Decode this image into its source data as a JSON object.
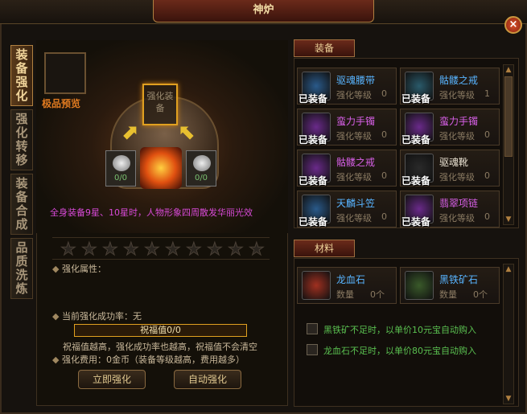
{
  "title": "神炉",
  "close_label": "×",
  "side_tabs": [
    {
      "label": "装备强化",
      "active": true
    },
    {
      "label": "强化转移",
      "active": false
    },
    {
      "label": "装备合成",
      "active": false
    },
    {
      "label": "品质洗炼",
      "active": false
    }
  ],
  "preview_label": "极品预览",
  "equip_slot_label": "强化装备",
  "stone_left_count": "0/0",
  "stone_right_count": "0/0",
  "description": "全身装备9星、10星时，人物形象四周散发华丽光效",
  "stars_total": 10,
  "stars_filled": 0,
  "attr_label": "强化属性：",
  "success_rate_label": "当前强化成功率：无",
  "bless_label": "祝福值0/0",
  "bless_fraction": 0,
  "bless_note": "祝福值越高，强化成功率也越高，祝福值不会清空",
  "cost_label": "强化费用：0金币（装备等级越高，费用越多）",
  "btn_strengthen": "立即强化",
  "btn_auto": "自动强化",
  "equip_tab": "装备",
  "equipped_badge": "已装备",
  "level_label": "强化等级",
  "equipment": [
    {
      "name": "驱魂腰带",
      "level": "0",
      "color": "#58b4ff",
      "icon": "belt-icon",
      "iconbg": "#2a5a8a"
    },
    {
      "name": "骷髅之戒",
      "level": "1",
      "color": "#58b4ff",
      "icon": "ring-icon",
      "iconbg": "#2a5a6a"
    },
    {
      "name": "蛮力手镯",
      "level": "0",
      "color": "#d860e8",
      "icon": "bracelet-icon",
      "iconbg": "#6a2a8a"
    },
    {
      "name": "蛮力手镯",
      "level": "0",
      "color": "#d860e8",
      "icon": "bracelet-icon",
      "iconbg": "#6a2a8a"
    },
    {
      "name": "骷髅之戒",
      "level": "0",
      "color": "#d860e8",
      "icon": "ring-icon",
      "iconbg": "#6a2a8a"
    },
    {
      "name": "驱魂靴",
      "level": "0",
      "color": "#e8e0d0",
      "icon": "boots-icon",
      "iconbg": "#2a2a2a"
    },
    {
      "name": "天麟斗笠",
      "level": "0",
      "color": "#58b4ff",
      "icon": "hat-icon",
      "iconbg": "#2a5a8a"
    },
    {
      "name": "翡翠项链",
      "level": "0",
      "color": "#d860e8",
      "icon": "necklace-icon",
      "iconbg": "#6a2a8a"
    }
  ],
  "material_tab": "材料",
  "qty_label": "数量",
  "materials": [
    {
      "name": "龙血石",
      "qty": "0个",
      "color": "#58b4ff",
      "icon": "bloodstone-icon",
      "iconbg": "#a03020"
    },
    {
      "name": "黑铁矿石",
      "qty": "0个",
      "color": "#58b4ff",
      "icon": "iron-ore-icon",
      "iconbg": "#3a5a2a"
    }
  ],
  "auto_buy_iron": "黑铁矿不足时，以单价10元宝自动购入",
  "auto_buy_blood": "龙血石不足时，以单价80元宝自动购入"
}
